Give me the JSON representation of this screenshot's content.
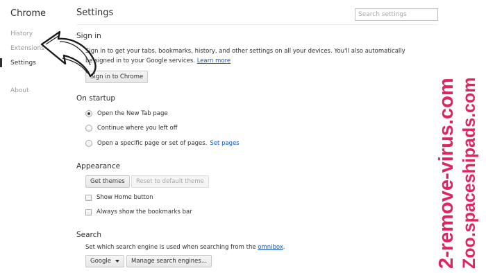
{
  "sidebar": {
    "brand": "Chrome",
    "items": [
      {
        "label": "History"
      },
      {
        "label": "Extensions"
      },
      {
        "label": "Settings"
      },
      {
        "label": "About"
      }
    ]
  },
  "header": {
    "title": "Settings",
    "search_placeholder": "Search settings"
  },
  "sign_in": {
    "title": "Sign in",
    "line1": "Sign in to get your tabs, bookmarks, history, and other settings on all your devices. You'll also automatically",
    "line2": "be signed in to your Google services.",
    "learn_more": "Learn more",
    "button": "Sign in to Chrome"
  },
  "on_startup": {
    "title": "On startup",
    "options": [
      {
        "label": "Open the New Tab page",
        "checked": true
      },
      {
        "label": "Continue where you left off",
        "checked": false
      },
      {
        "label": "Open a specific page or set of pages.",
        "checked": false
      }
    ],
    "set_pages_link": "Set pages"
  },
  "appearance": {
    "title": "Appearance",
    "get_themes": "Get themes",
    "reset_theme": "Reset to default theme",
    "show_home": "Show Home button",
    "show_bookmarks": "Always show the bookmarks bar"
  },
  "search": {
    "title": "Search",
    "description": "Set which search engine is used when searching from the",
    "omnibox_link": "omnibox",
    "description_end": ".",
    "engine": "Google",
    "manage_button": "Manage search engines..."
  },
  "watermark": {
    "line1": "2-remove-virus.com",
    "line2": "Zoo.spaceshipads.com",
    "color": "#e0245e"
  },
  "colors": {
    "link": "#1155cc",
    "text": "#303030",
    "muted": "#999999"
  }
}
